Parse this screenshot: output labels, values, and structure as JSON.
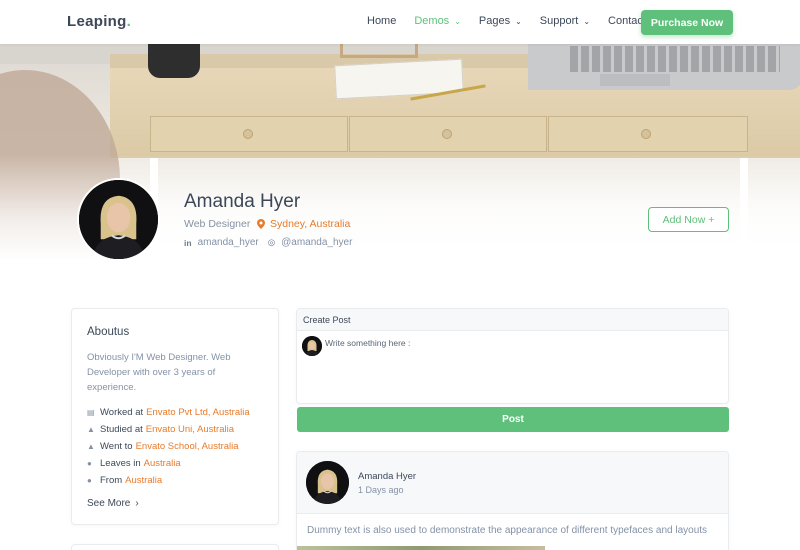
{
  "brand": {
    "name": "Leaping",
    "dot": "."
  },
  "nav": {
    "items": [
      {
        "label": "Home",
        "has_dropdown": false,
        "active": false
      },
      {
        "label": "Demos",
        "has_dropdown": true,
        "active": true
      },
      {
        "label": "Pages",
        "has_dropdown": true,
        "active": false
      },
      {
        "label": "Support",
        "has_dropdown": true,
        "active": false
      },
      {
        "label": "Contact",
        "has_dropdown": false,
        "active": false
      }
    ],
    "cta_label": "Purchase Now"
  },
  "profile": {
    "name": "Amanda Hyer",
    "role": "Web Designer",
    "location": "Sydney, Australia",
    "linkedin": "amanda_hyer",
    "skype": "@amanda_hyer",
    "linkedin_icon": "in",
    "add_label": "Add Now +"
  },
  "about": {
    "title": "Aboutus",
    "bio": "Obviously I'M Web Designer. Web Developer with over 3 years of experience.",
    "facts": [
      {
        "icon": "briefcase-icon",
        "prefix": "Worked at",
        "link": "Envato Pvt Ltd, Australia"
      },
      {
        "icon": "graduation-cap-icon",
        "prefix": "Studied at",
        "link": "Envato Uni, Australia"
      },
      {
        "icon": "graduation-cap-icon",
        "prefix": "Went to",
        "link": "Envato School, Australia"
      },
      {
        "icon": "map-pin-icon",
        "prefix": "Leaves in",
        "link": "Australia"
      },
      {
        "icon": "map-pin-icon",
        "prefix": "From",
        "link": "Australia"
      }
    ],
    "see_more": "See More"
  },
  "create_post": {
    "title": "Create Post",
    "placeholder": "Write something here :",
    "button": "Post"
  },
  "feed": {
    "author": "Amanda Hyer",
    "time": "1 Days ago",
    "text": "Dummy text is also used to demonstrate the appearance of different typefaces and layouts"
  },
  "colors": {
    "accent": "#5ec07a",
    "link": "#e87b2a",
    "text": "#3c4858",
    "muted": "#8492a6"
  }
}
